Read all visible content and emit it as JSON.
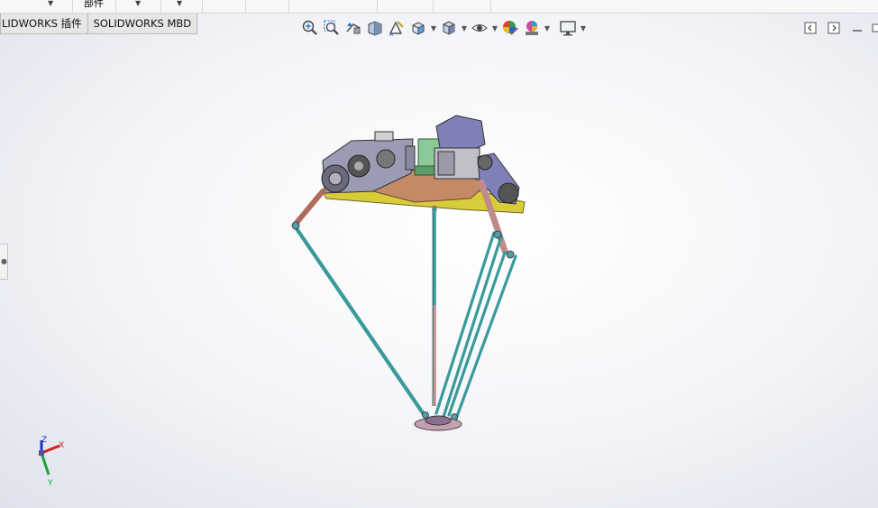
{
  "top_strip": {
    "label": "部件"
  },
  "tabs": [
    {
      "label": "LIDWORKS 插件"
    },
    {
      "label": "SOLIDWORKS MBD"
    }
  ],
  "view_toolbar": {
    "icons": [
      "zoom-to-fit-icon",
      "zoom-to-area-icon",
      "previous-view-icon",
      "section-view-icon",
      "dynamic-annotation-icon",
      "view-orientation-icon",
      "display-style-icon",
      "hide-show-items-icon",
      "edit-appearance-icon",
      "apply-scene-icon",
      "view-settings-icon"
    ]
  },
  "triad": {
    "x_label": "X",
    "y_label": "Y",
    "z_label": "Z",
    "colors": {
      "x": "#d02020",
      "y": "#20a040",
      "z": "#2030c0"
    }
  },
  "colors": {
    "accent": "#1e66c8",
    "rod": "#3a9a9a",
    "plate_yellow": "#d8cc3a",
    "plate_wood": "#c48a68",
    "motor_green": "#8cc99a",
    "gearbox_grey": "#9b9bb3",
    "arm_pink": "#c08a8a"
  }
}
